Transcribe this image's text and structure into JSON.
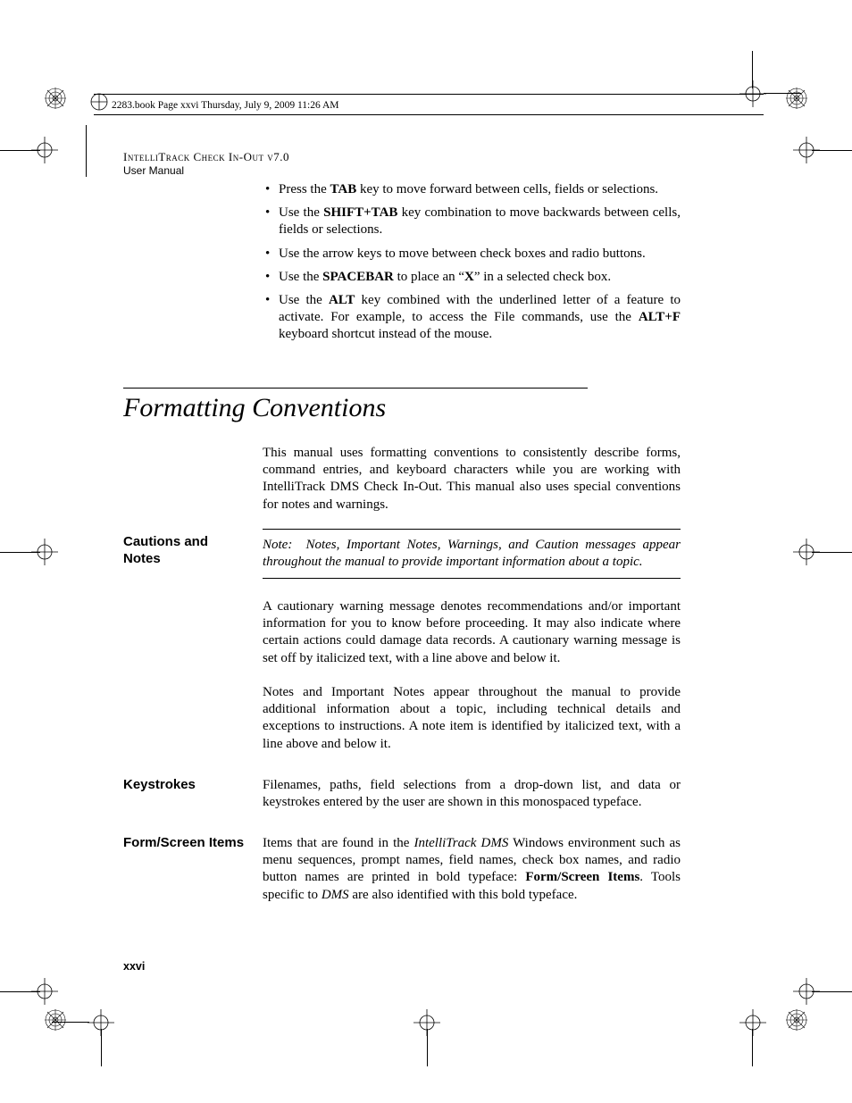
{
  "frame": {
    "book_tag": "2283.book  Page xxvi  Thursday, July 9, 2009  11:26 AM"
  },
  "running_head": {
    "title": "IntelliTrack Check In-Out v7.0",
    "sub": "User Manual"
  },
  "bullets": [
    {
      "pre": "Press the ",
      "bold1": "TAB",
      "mid": " key to move forward between cells, fields or selections."
    },
    {
      "pre": "Use the ",
      "bold1": "SHIFT+TAB",
      "mid": " key combination to move backwards between cells, fields or selections."
    },
    {
      "pre": "Use the arrow keys to move between check boxes and radio buttons."
    },
    {
      "pre": "Use the ",
      "bold1": "SPACEBAR",
      "mid": " to place an “",
      "bold2": "X",
      "post": "” in a selected check box."
    },
    {
      "pre": "Use the ",
      "bold1": "ALT",
      "mid": " key combined with the underlined letter of a feature to activate. For example, to access the File commands, use the ",
      "bold2": "ALT+F",
      "post": " keyboard shortcut instead of the mouse."
    }
  ],
  "section": {
    "title": "Formatting Conventions",
    "intro": "This manual uses formatting conventions to consistently describe forms, command entries, and keyboard characters while you are working with IntelliTrack DMS Check In-Out. This manual also uses special conventions for notes and warnings."
  },
  "cautions": {
    "label": "Cautions and Notes",
    "note_lead": "Note:",
    "note_body": "Notes, Important Notes, Warnings, and Caution messages appear throughout the manual to provide important information about a topic.",
    "para1": "A cautionary warning message denotes recommendations and/or important information for you to know before proceeding. It may also indicate where certain actions could damage data records. A cautionary warning message is set off by italicized text, with a line above and below it.",
    "para2": "Notes and Important Notes appear throughout the manual to provide additional information about a topic, including technical details and exceptions to instructions. A note item is identified by italicized text, with a line above and below it."
  },
  "keystrokes": {
    "label": "Keystrokes",
    "body": "Filenames, paths, field selections from a drop-down list, and data or keystrokes entered by the user are shown in this monospaced typeface."
  },
  "formscreen": {
    "label": "Form/Screen Items",
    "pre": "Items that are found in the ",
    "em1": "IntelliTrack DMS",
    "mid": " Windows environment such as menu sequences, prompt names, field names, check box names, and radio button names are printed in bold typeface: ",
    "bold1": "Form/Screen Items",
    "mid2": ". Tools specific to ",
    "em2": "DMS",
    "post": " are also identified with this bold typeface."
  },
  "page_number": "xxvi"
}
